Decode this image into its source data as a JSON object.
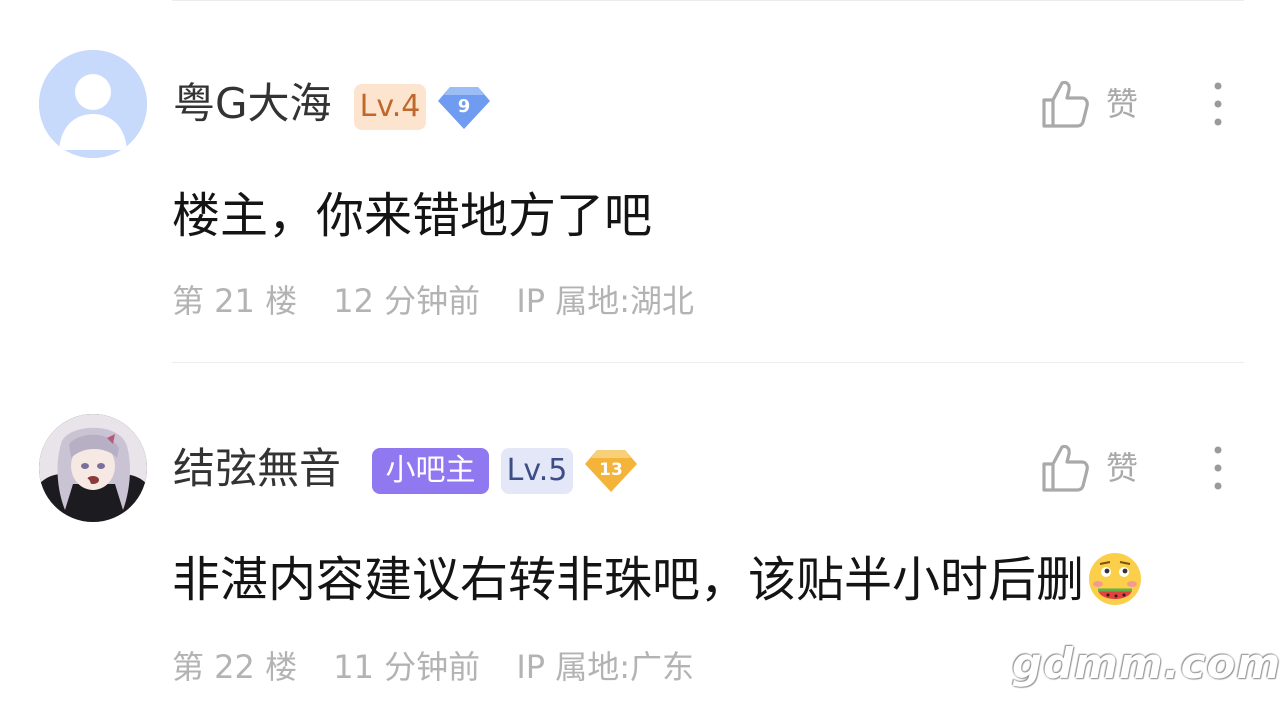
{
  "comments": [
    {
      "username": "粤G大海",
      "level_badge": "Lv.4",
      "gem_level": "9",
      "like_label": "赞",
      "content": "楼主，你来错地方了吧",
      "floor": "第 21 楼",
      "time": "12 分钟前",
      "ip": "IP 属地:湖北"
    },
    {
      "username": "结弦無音",
      "role_badge": "小吧主",
      "level_badge": "Lv.5",
      "gem_level": "13",
      "like_label": "赞",
      "content": "非湛内容建议右转非珠吧，该贴半小时后删",
      "floor": "第 22 楼",
      "time": "11 分钟前",
      "ip": "IP 属地:广东"
    }
  ],
  "watermark": "gdmm.com",
  "colors": {
    "lv4_badge_bg": "#fde4cf",
    "lv4_badge_text": "#c0682b",
    "lv5_badge_bg": "#e3e7f8",
    "lv5_badge_text": "#3d4d86",
    "owner_badge_bg": "#8f78f0",
    "gem_blue": "#6f9bf0",
    "gem_gold": "#f4b43a",
    "meta_text": "#b3b3b3"
  }
}
